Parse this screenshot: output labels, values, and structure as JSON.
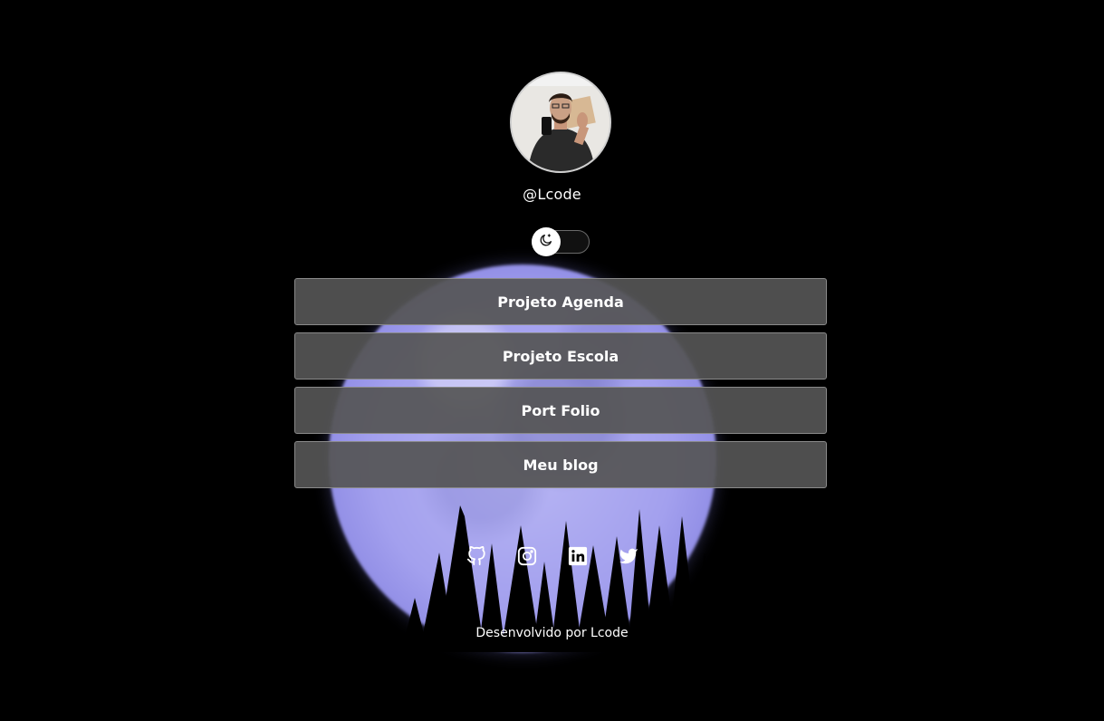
{
  "profile": {
    "handle": "@Lcode"
  },
  "theme_toggle": {
    "icon": "moon-icon"
  },
  "links": [
    {
      "label": "Projeto Agenda"
    },
    {
      "label": "Projeto Escola"
    },
    {
      "label": "Port Folio"
    },
    {
      "label": "Meu blog"
    }
  ],
  "socials": [
    {
      "icon": "github-icon"
    },
    {
      "icon": "instagram-icon"
    },
    {
      "icon": "linkedin-icon"
    },
    {
      "icon": "twitter-icon"
    }
  ],
  "footer": {
    "text": "Desenvolvido por Lcode"
  },
  "colors": {
    "background": "#000000",
    "button_bg": "#555555",
    "moon": "#a3a0ee"
  }
}
